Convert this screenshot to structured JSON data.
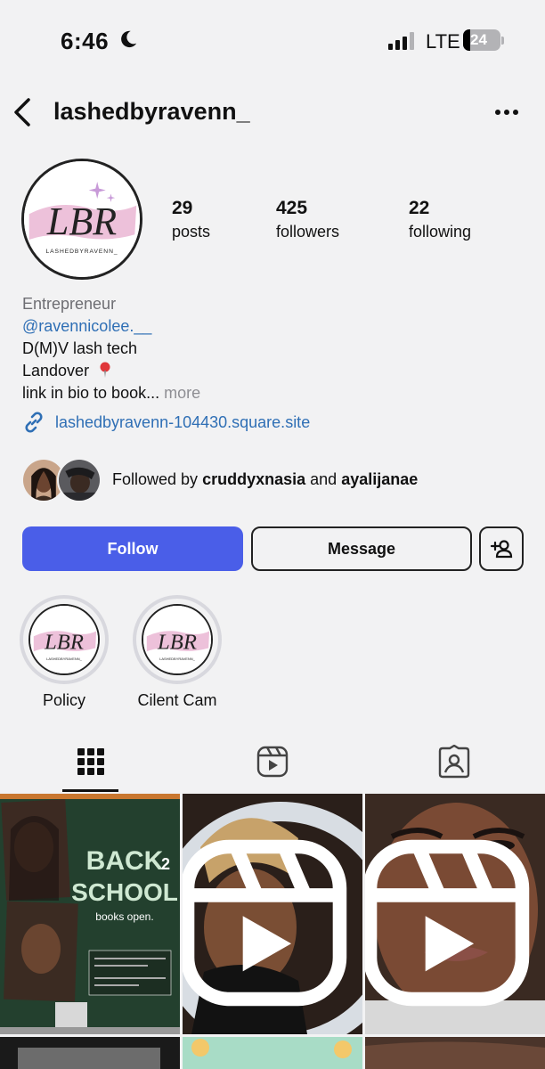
{
  "status_bar": {
    "time": "6:46",
    "network": "LTE",
    "battery": "24"
  },
  "header": {
    "username": "lashedbyravenn_"
  },
  "profile": {
    "avatar_monogram": "LBR",
    "avatar_wordmark": "LASHEDBYRAVENN_",
    "stats": [
      {
        "value": "29",
        "label": "posts"
      },
      {
        "value": "425",
        "label": "followers"
      },
      {
        "value": "22",
        "label": "following"
      }
    ],
    "bio": {
      "category": "Entrepreneur",
      "mention": "@ravennicolee.__",
      "line1": "D(M)V lash tech",
      "line2": "Landover",
      "line3": "link in bio to book...",
      "more": "more"
    },
    "link": "lashedbyravenn-104430.square.site",
    "followed_by": {
      "prefix": "Followed by",
      "user1": "cruddyxnasia",
      "conjunction": "and",
      "user2": "ayalijanae"
    }
  },
  "actions": {
    "follow_label": "Follow",
    "message_label": "Message"
  },
  "highlights": [
    {
      "label": "Policy"
    },
    {
      "label": "Cilent Cam"
    }
  ],
  "tabs": [
    {
      "name": "posts-grid",
      "icon": "grid-icon",
      "active": true
    },
    {
      "name": "reels",
      "icon": "reels-icon",
      "active": false
    },
    {
      "name": "tagged",
      "icon": "tagged-icon",
      "active": false
    }
  ],
  "posts": [
    {
      "kind": "flyer",
      "headline_1": "BACK",
      "headline_2": "2",
      "headline_3": "SCHOOL",
      "subtitle": "books open."
    },
    {
      "kind": "reel"
    },
    {
      "kind": "reel"
    }
  ],
  "colors": {
    "accent_blue": "#4a5ee8",
    "link_blue": "#2f6fb5",
    "background": "#f2f2f3"
  }
}
